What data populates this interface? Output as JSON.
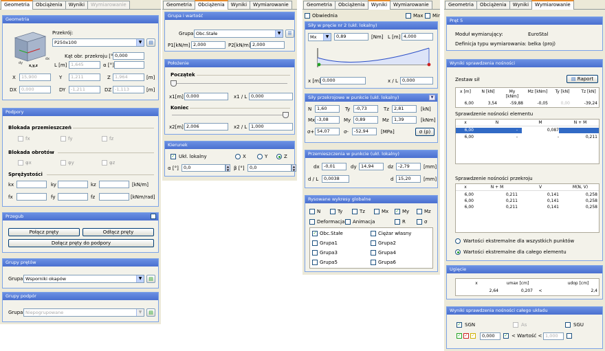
{
  "p1": {
    "tabs": [
      "Geometria",
      "Obciążenia",
      "Wyniki",
      "Wymiarowanie"
    ],
    "geom": {
      "title": "Geometria",
      "przekroj_label": "Przekrój:",
      "przekroj_value": "P250x100",
      "kat_label": "Kąt obr. przekroju [°]",
      "kat_value": "0,000",
      "L_label": "L [m]",
      "L_value": "1,645",
      "alpha_label": "α [°]",
      "alpha_value": "",
      "X_label": "X",
      "X_value": "15,900",
      "Y_label": "Y",
      "Y_value": "1,211",
      "Z_label": "Z",
      "Z_value": "1,964",
      "m1": "[m]",
      "DX_label": "DX",
      "DX_value": "0,000",
      "DY_label": "DY",
      "DY_value": "-1,211",
      "DZ_label": "DZ",
      "DZ_value": "-1,113",
      "m2": "[m]",
      "axes": {
        "dy": "dy",
        "dx": "dx",
        "xyz": "x,y,z"
      }
    },
    "podpory": {
      "title": "Podpory",
      "blok_p": "Blokada przemieszczeń",
      "fx": "fx",
      "fy": "fy",
      "fz": "fz",
      "blok_o": "Blokada obrotów",
      "px": "φx",
      "py": "φy",
      "pz": "φz",
      "spr": "Sprężystości",
      "kx": "kx",
      "ky": "ky",
      "kz": "kz",
      "kunit": "[kN/m]",
      "fxx": "fx",
      "fyy": "fy",
      "fzz": "fz",
      "funit": "[kNm/rad]"
    },
    "przegub": {
      "title": "Przegub",
      "polacz": "Połącz pręty",
      "odlacz": "Odłącz pręty",
      "dolacz": "Dołącz pręty do podpory"
    },
    "gp": {
      "title": "Grupy prętów",
      "label": "Grupa",
      "value": "Wsporniki okapów"
    },
    "gpod": {
      "title": "Grupy podpór",
      "label": "Grupa",
      "value": "Niepogrupowane"
    }
  },
  "p2": {
    "tabs": [
      "Geometria",
      "Obciążenia",
      "Wyniki",
      "Wymiarowanie"
    ],
    "gw": {
      "title": "Grupa i wartość",
      "grupa_label": "Grupa",
      "grupa_value": "Obc.Stałe",
      "p1_label": "P1[kN/m]",
      "p1_value": "2,000",
      "p2_label": "P2[kN/m]",
      "p2_value": "2,000"
    },
    "pol": {
      "title": "Położenie",
      "poczatek": "Początek",
      "x1_label": "x1[m]",
      "x1_value": "0,000",
      "x1l_label": "x1 / L",
      "x1l_value": "0,000",
      "koniec": "Koniec",
      "x2_label": "x2[m]",
      "x2_value": "2,006",
      "x2l_label": "x2 / L",
      "x2l_value": "1,000"
    },
    "kier": {
      "title": "Kierunek",
      "ukl": "Ukł. lokalny",
      "X": "X",
      "Y": "Y",
      "Z": "Z",
      "alpha_label": "α [°]",
      "alpha_value": "0,0",
      "beta_label": "β [°]",
      "beta_value": "0,0"
    }
  },
  "p3": {
    "tabs": [
      "Geometria",
      "Obciążenia",
      "Wyniki",
      "Wymiarowanie"
    ],
    "top": {
      "obwiednia": "Obwiednia",
      "max": "Max",
      "min": "Min"
    },
    "sily": {
      "title": "Siły w pręcie nr 2 (ukł. lokalny)",
      "comp": "Mx",
      "value": "0,89",
      "unit": "[Nm]",
      "L_label": "L [m]",
      "L_value": "4,000",
      "x_label": "x [m]",
      "x_value": "0,000",
      "xl_label": "x / L",
      "xl_value": "0,000"
    },
    "przekr": {
      "title": "Siły przekrojowe w punkcie (ukł. lokalny)",
      "N": "N",
      "N_v": "1,60",
      "Ty": "Ty",
      "Ty_v": "-0,73",
      "Tz": "Tz",
      "Tz_v": "2,81",
      "u1": "[kN]",
      "Mx": "Mx",
      "Mx_v": "-3,08",
      "My": "My",
      "My_v": "0,89",
      "Mz": "Mz",
      "Mz_v": "1,39",
      "u2": "[kNm]",
      "sp": "σ+",
      "sp_v": "54,07",
      "sm": "σ-",
      "sm_v": "-52,94",
      "u3": "[MPa]",
      "sbtn": "σ (p)"
    },
    "przem": {
      "title": "Przemieszczenia w punkcie (ukł. lokalny)",
      "dx": "dx",
      "dx_v": "-0,01",
      "dy": "dy",
      "dy_v": "14,94",
      "dz": "dz",
      "dz_v": "-2,79",
      "u": "[mm]",
      "dl": "d / L",
      "dl_v": "0,0038",
      "d": "d",
      "d_v": "15,20",
      "u2": "[mm]"
    },
    "rys": {
      "title": "Rysowane wykresy globalne",
      "N": "N",
      "Ty": "Ty",
      "Tz": "Tz",
      "Mx": "Mx",
      "My": "My",
      "Mz": "Mz",
      "def": "Deformacja",
      "anim": "Animacja",
      "R": "R",
      "sigma": "σ",
      "groups": [
        "Obc.Stałe",
        "Ciężar własny",
        "Grupa1",
        "Grupa2",
        "Grupa3",
        "Grupa4",
        "Grupa5",
        "Grupa6"
      ]
    }
  },
  "p4": {
    "tabs": [
      "Geometria",
      "Obciążenia",
      "Wyniki",
      "Wymiarowanie"
    ],
    "pret": {
      "title": "Pręt 5",
      "modul_label": "Moduł wymiarujący:",
      "modul_value": "EuroStal",
      "def_label": "Definicja typu wymiarowania:",
      "def_value": "belka (proj)"
    },
    "wyn": {
      "title": "Wyniki sprawdzenia nośności",
      "zestaw": "Zestaw sił",
      "raport": "Raport",
      "h1": [
        "x [m]",
        "N [kN]",
        "My [kNm]",
        "Mz [kNm]",
        "Ty [kN]",
        "Tz [kN]"
      ],
      "r1": [
        "6,00",
        "3,54",
        "-59,88",
        "-0,05",
        "0,00",
        "-39,24"
      ],
      "elem_title": "Sprawdzenie nośności elementu",
      "h2": [
        "x",
        "N",
        "M",
        "N + M"
      ],
      "r2": [
        [
          "6,00",
          "-",
          "0,087",
          ""
        ],
        [
          "6,00",
          "-",
          "-",
          "0,211"
        ]
      ],
      "prz_title": "Sprawdzenie nośności przekroju",
      "h3": [
        "x",
        "N + M",
        "V",
        "M(N, V)"
      ],
      "r3": [
        [
          "6,00",
          "0,211",
          "0,141",
          "0,258"
        ],
        [
          "6,00",
          "0,211",
          "0,141",
          "0,258"
        ],
        [
          "6,00",
          "0,211",
          "0,141",
          "0,258"
        ]
      ],
      "opt1": "Wartości ekstremalne dla wszystkich punktów",
      "opt2": "Wartości ekstremalne dla całego elementu"
    },
    "ug": {
      "title": "Ugięcie",
      "h": [
        "x",
        "umax [cm]",
        "udop [cm]"
      ],
      "r": [
        "2,64",
        "0,207",
        "<",
        "2,4"
      ]
    },
    "caly": {
      "title": "Wyniki sprawdzenia nośności całego układu",
      "sgn": "SGN",
      "as": "As",
      "sgu": "SGU",
      "v1": "0,000",
      "cmp": "< Wartość <",
      "v2": "1,000"
    }
  }
}
